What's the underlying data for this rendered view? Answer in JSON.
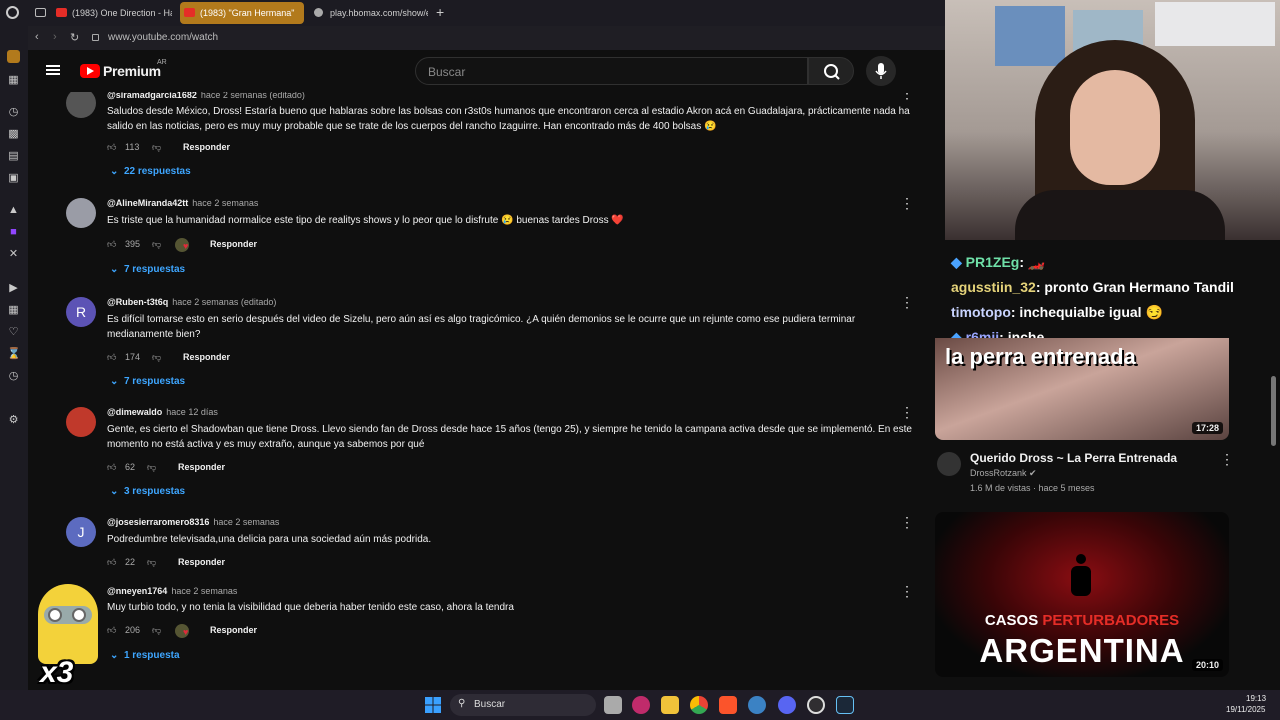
{
  "browser": {
    "tabs": [
      {
        "label": "(1983) One Direction - Ha"
      },
      {
        "label": "(1983) \"Gran Hermana\""
      },
      {
        "label": "play.hbomax.com/show/e"
      }
    ],
    "url": "www.youtube.com/watch"
  },
  "youtube": {
    "logo_text": "Premium",
    "region": "AR",
    "search_placeholder": "Buscar"
  },
  "comments": [
    {
      "user": "@siramadgarcia1682",
      "time": "hace 2 semanas (editado)",
      "text": "Saludos desde México, Dross! Estaría bueno que hablaras sobre las bolsas con r3st0s humanos que encontraron cerca al estadio Akron acá en Guadalajara, prácticamente nada ha salido en las noticias, pero es muy muy probable que se trate de los cuerpos del rancho Izaguirre. Han encontrado más de 400 bolsas 😢",
      "likes": "113",
      "reply_label": "Responder",
      "replies": "22 respuestas"
    },
    {
      "user": "@AlineMiranda42tt",
      "time": "hace 2 semanas",
      "text": "Es triste que la humanidad normalice este tipo de realitys shows y lo peor que lo disfrute 😢 buenas tardes Dross ❤️",
      "likes": "395",
      "reply_label": "Responder",
      "replies": "7 respuestas"
    },
    {
      "user": "@Ruben-t3t6q",
      "time": "hace 2 semanas (editado)",
      "text": "Es difícil tomarse esto en serio después del video de Sizelu, pero aún así es algo tragicómico. ¿A quién demonios se le ocurre que un rejunte como ese pudiera terminar medianamente bien?",
      "likes": "174",
      "reply_label": "Responder",
      "replies": "7 respuestas",
      "avatar_letter": "R"
    },
    {
      "user": "@dimewaldo",
      "time": "hace 12 días",
      "text": "Gente, es cierto el Shadowban que tiene Dross. Llevo siendo fan de Dross desde hace 15 años (tengo 25), y siempre he tenido la campana activa desde que se implementó. En este momento no está activa y es muy extraño, aunque ya sabemos por qué",
      "likes": "62",
      "reply_label": "Responder",
      "replies": "3 respuestas"
    },
    {
      "user": "@josesierraromero8316",
      "time": "hace 2 semanas",
      "text": "Podredumbre televisada,una delicia para una sociedad aún más podrida.",
      "likes": "22",
      "reply_label": "Responder",
      "avatar_letter": "J"
    },
    {
      "user": "@nneyen1764",
      "time": "hace 2 semanas",
      "text": "Muy turbio todo, y no tenia la visibilidad que deberia haber tenido este caso, ahora la tendra",
      "likes": "206",
      "reply_label": "Responder",
      "replies": "1 respuesta"
    }
  ],
  "stream_chat": [
    {
      "user": "PR1ZEg",
      "msg": ": 🏎️",
      "color": "#6fe0a8"
    },
    {
      "user": "agusstiin_32",
      "msg": ": pronto Gran Hermano Tandil",
      "color": "#e5d37a"
    },
    {
      "user": "timotopo",
      "msg": ": inchequialbe igual 😏",
      "color": "#c9d4ff"
    },
    {
      "user": "r6mii",
      "msg": ": inche",
      "color": "#9aa6ff"
    }
  ],
  "related": [
    {
      "overlay_text": "la perra entrenada",
      "duration": "17:28",
      "title": "Querido Dross ~ La Perra Entrenada",
      "channel": "DrossRotzank",
      "meta": "1.6 M de vistas · hace 5 meses"
    },
    {
      "overlay_line1": "CASOS",
      "overlay_line1b": "PERTURBADORES",
      "overlay_line2": "ARGENTINA",
      "duration": "20:10"
    }
  ],
  "overlay": {
    "multiplier": "x3"
  },
  "taskbar": {
    "search_label": "Buscar",
    "time": "19:13",
    "date": "19/11/2025"
  },
  "colors": {
    "accent_blue": "#3ea6ff",
    "youtube_red": "#ff0000",
    "tab_active": "#b27a1c"
  }
}
